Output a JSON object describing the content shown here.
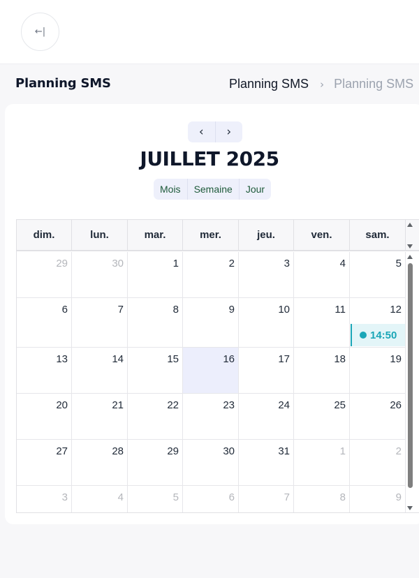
{
  "topbar": {
    "collapse_icon": "←|"
  },
  "page": {
    "title": "Planning SMS"
  },
  "breadcrumb": {
    "items": [
      "Planning SMS",
      "Planning SMS"
    ],
    "separator": "›"
  },
  "calendar": {
    "prev_icon": "‹",
    "next_icon": "›",
    "title": "JUILLET 2025",
    "views": [
      "Mois",
      "Semaine",
      "Jour"
    ],
    "weekdays": [
      "dim.",
      "lun.",
      "mar.",
      "mer.",
      "jeu.",
      "ven.",
      "sam."
    ],
    "today": 16,
    "weeks": [
      [
        {
          "n": "29",
          "o": true
        },
        {
          "n": "30",
          "o": true
        },
        {
          "n": "1"
        },
        {
          "n": "2"
        },
        {
          "n": "3"
        },
        {
          "n": "4"
        },
        {
          "n": "5"
        }
      ],
      [
        {
          "n": "6"
        },
        {
          "n": "7"
        },
        {
          "n": "8"
        },
        {
          "n": "9"
        },
        {
          "n": "10"
        },
        {
          "n": "11"
        },
        {
          "n": "12",
          "event": "14:50"
        }
      ],
      [
        {
          "n": "13"
        },
        {
          "n": "14"
        },
        {
          "n": "15"
        },
        {
          "n": "16",
          "today": true
        },
        {
          "n": "17"
        },
        {
          "n": "18"
        },
        {
          "n": "19"
        }
      ],
      [
        {
          "n": "20"
        },
        {
          "n": "21"
        },
        {
          "n": "22"
        },
        {
          "n": "23"
        },
        {
          "n": "24"
        },
        {
          "n": "25"
        },
        {
          "n": "26"
        }
      ],
      [
        {
          "n": "27"
        },
        {
          "n": "28"
        },
        {
          "n": "29"
        },
        {
          "n": "30"
        },
        {
          "n": "31"
        },
        {
          "n": "1",
          "o": true
        },
        {
          "n": "2",
          "o": true
        }
      ],
      [
        {
          "n": "3",
          "o": true
        },
        {
          "n": "4",
          "o": true
        },
        {
          "n": "5",
          "o": true
        },
        {
          "n": "6",
          "o": true
        },
        {
          "n": "7",
          "o": true
        },
        {
          "n": "8",
          "o": true
        },
        {
          "n": "9",
          "o": true
        }
      ]
    ]
  },
  "colors": {
    "event": "#1aa6b7",
    "today_bg": "#eceefc",
    "view_text": "#1e5a3a"
  }
}
